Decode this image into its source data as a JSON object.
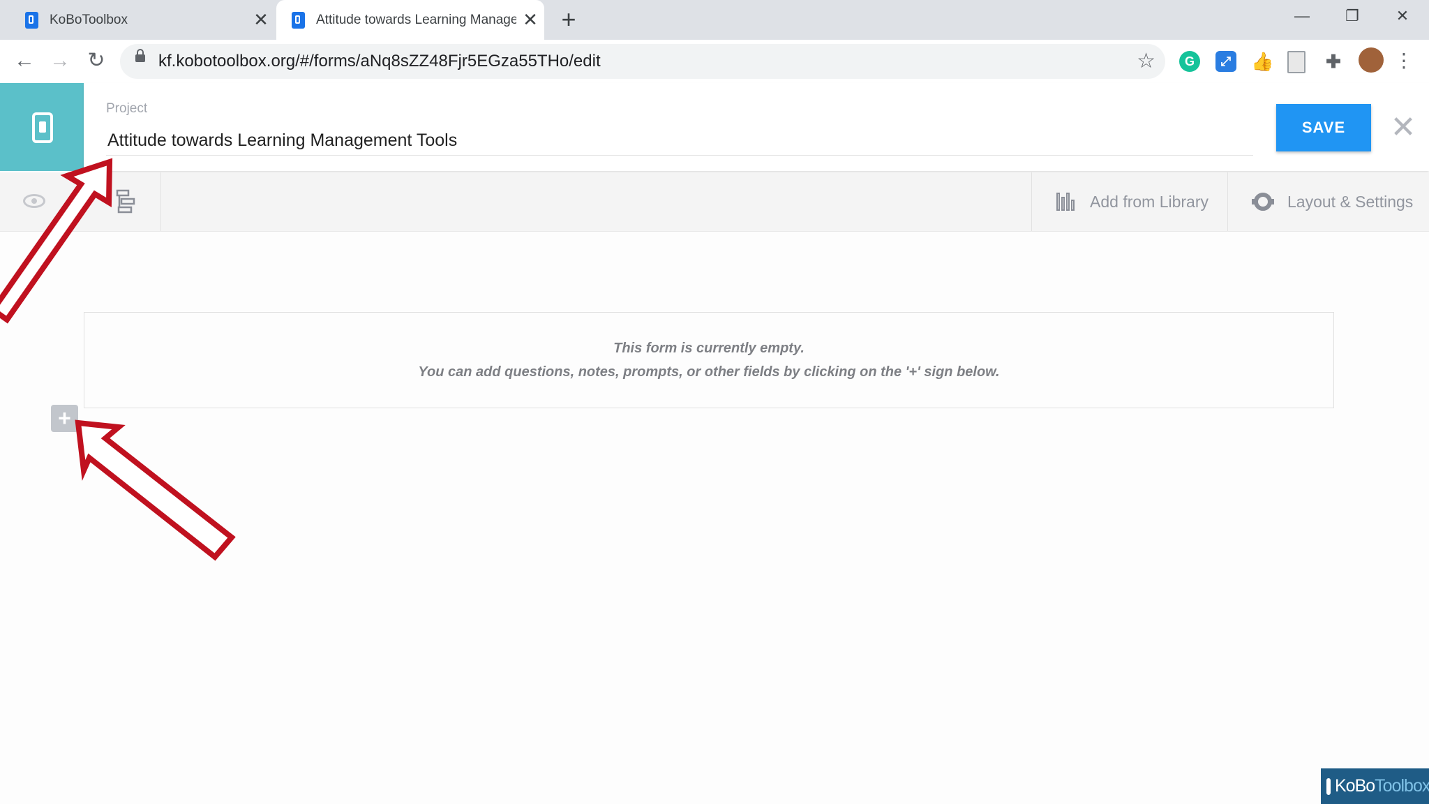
{
  "browser": {
    "tabs": [
      {
        "title": "KoBoToolbox",
        "active": false
      },
      {
        "title": "Attitude towards Learning Management Tools",
        "active": true
      }
    ],
    "new_tab_icon": "plus",
    "url": "kf.kobotoolbox.org/#/forms/aNq8sZZ48Fjr5EGza55THo/edit"
  },
  "header": {
    "project_label": "Project",
    "project_name": "Attitude towards Learning Management Tools",
    "save_label": "SAVE"
  },
  "subbar": {
    "add_from_library": "Add from Library",
    "layout_settings": "Layout & Settings"
  },
  "form": {
    "empty_line1": "This form is currently empty.",
    "empty_line2": "You can add questions, notes, prompts, or other fields by clicking on the '+' sign below.",
    "add_icon": "+"
  },
  "watermark": {
    "part1": "KoBo",
    "part2": "Toolbox"
  },
  "colors": {
    "accent": "#2095f3",
    "logo_bg": "#5bc0c9",
    "annotation_arrow": "#c0111f"
  }
}
